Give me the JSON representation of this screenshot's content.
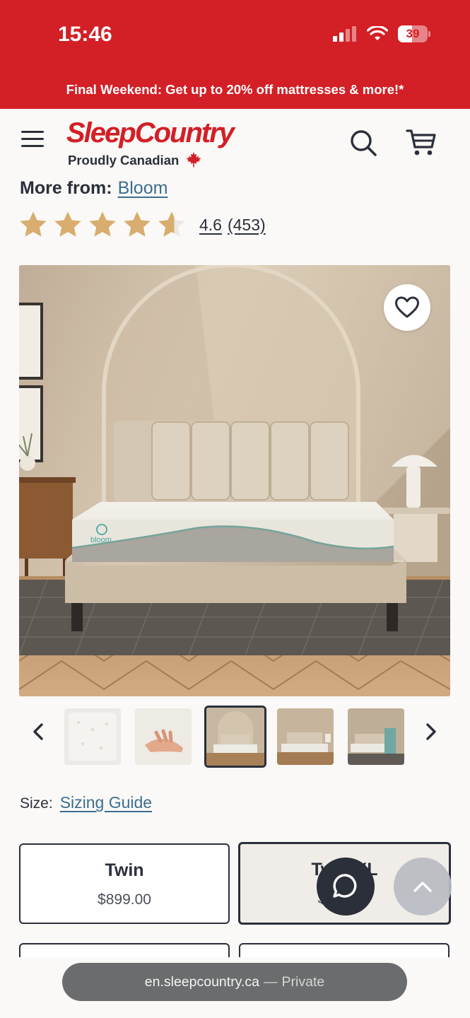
{
  "status_bar": {
    "time": "15:46",
    "battery": "39"
  },
  "promo": {
    "text": "Final Weekend: Get up to 20% off mattresses & more!*"
  },
  "header": {
    "logo_word": "SleepCountry",
    "logo_tagline": "Proudly Canadian"
  },
  "brand": {
    "label": "More from:",
    "link": "Bloom"
  },
  "rating": {
    "score": "4.6",
    "count": "(453)",
    "stars_value": 4.6,
    "stars_max": 5
  },
  "gallery": {
    "selected_index": 2,
    "thumbnail_count": 5
  },
  "size": {
    "label": "Size:",
    "guide_link": "Sizing Guide",
    "options": [
      {
        "name": "Twin",
        "price": "$899.00"
      },
      {
        "name": "Twin XL",
        "price": "$899.00"
      }
    ]
  },
  "browser": {
    "domain": "en.sleepcountry.ca",
    "separator": "—",
    "mode": "Private"
  },
  "colors": {
    "brand_red": "#d31f26",
    "star_gold": "#d8ad6f",
    "link_blue": "#3c6e8f",
    "dark": "#2b2f3a"
  }
}
